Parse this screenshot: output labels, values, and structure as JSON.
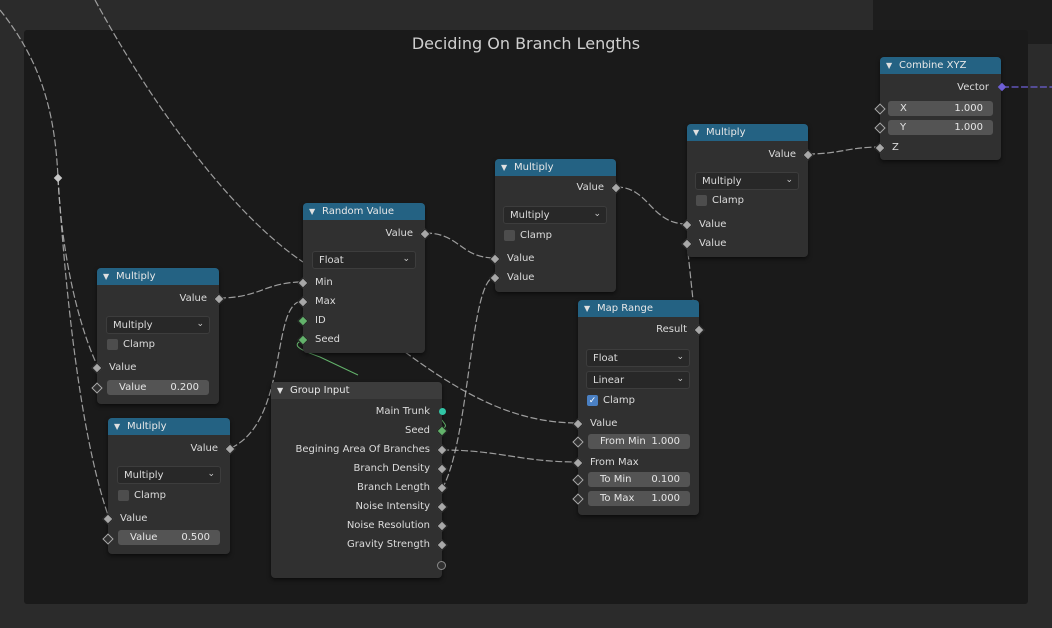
{
  "frame": {
    "title": "Deciding On Branch Lengths"
  },
  "nodes": {
    "multiply_a": {
      "title": "Multiply",
      "output": "Value",
      "operation": "Multiply",
      "clamp": "Clamp",
      "input1": "Value",
      "field_label": "Value",
      "field_value": "0.200"
    },
    "multiply_b": {
      "title": "Multiply",
      "output": "Value",
      "operation": "Multiply",
      "clamp": "Clamp",
      "input1": "Value",
      "field_label": "Value",
      "field_value": "0.500"
    },
    "random_value": {
      "title": "Random Value",
      "output": "Value",
      "data_type": "Float",
      "inputs": [
        "Min",
        "Max",
        "ID",
        "Seed"
      ]
    },
    "multiply_c": {
      "title": "Multiply",
      "output": "Value",
      "operation": "Multiply",
      "clamp": "Clamp",
      "input1": "Value",
      "input2": "Value"
    },
    "multiply_d": {
      "title": "Multiply",
      "output": "Value",
      "operation": "Multiply",
      "clamp": "Clamp",
      "input1": "Value",
      "input2": "Value"
    },
    "combine_xyz": {
      "title": "Combine XYZ",
      "output": "Vector",
      "x_label": "X",
      "x_value": "1.000",
      "y_label": "Y",
      "y_value": "1.000",
      "z_label": "Z"
    },
    "map_range": {
      "title": "Map Range",
      "output": "Result",
      "data_type": "Float",
      "interpolation": "Linear",
      "clamp": "Clamp",
      "clamp_checked": true,
      "input_value": "Value",
      "from_min_label": "From Min",
      "from_min": "1.000",
      "from_max": "From Max",
      "to_min_label": "To Min",
      "to_min": "0.100",
      "to_max_label": "To Max",
      "to_max": "1.000"
    },
    "group_input": {
      "title": "Group Input",
      "outputs": [
        "Main Trunk",
        "Seed",
        "Begining Area Of Branches",
        "Branch Density",
        "Branch Length",
        "Noise Intensity",
        "Noise Resolution",
        "Gravity Strength"
      ]
    }
  },
  "colors": {
    "header": "#246283",
    "canvas": "#2b2b2b",
    "frame": "#1a1a1a",
    "wire": "#b5b5b5",
    "geometry_socket": "#31c5a6",
    "int_socket": "#63b36b",
    "vector_socket": "#6e5fd6"
  },
  "icons": {
    "collapse": "chevron-down-icon",
    "dropdown": "dropdown-arrow-icon"
  }
}
